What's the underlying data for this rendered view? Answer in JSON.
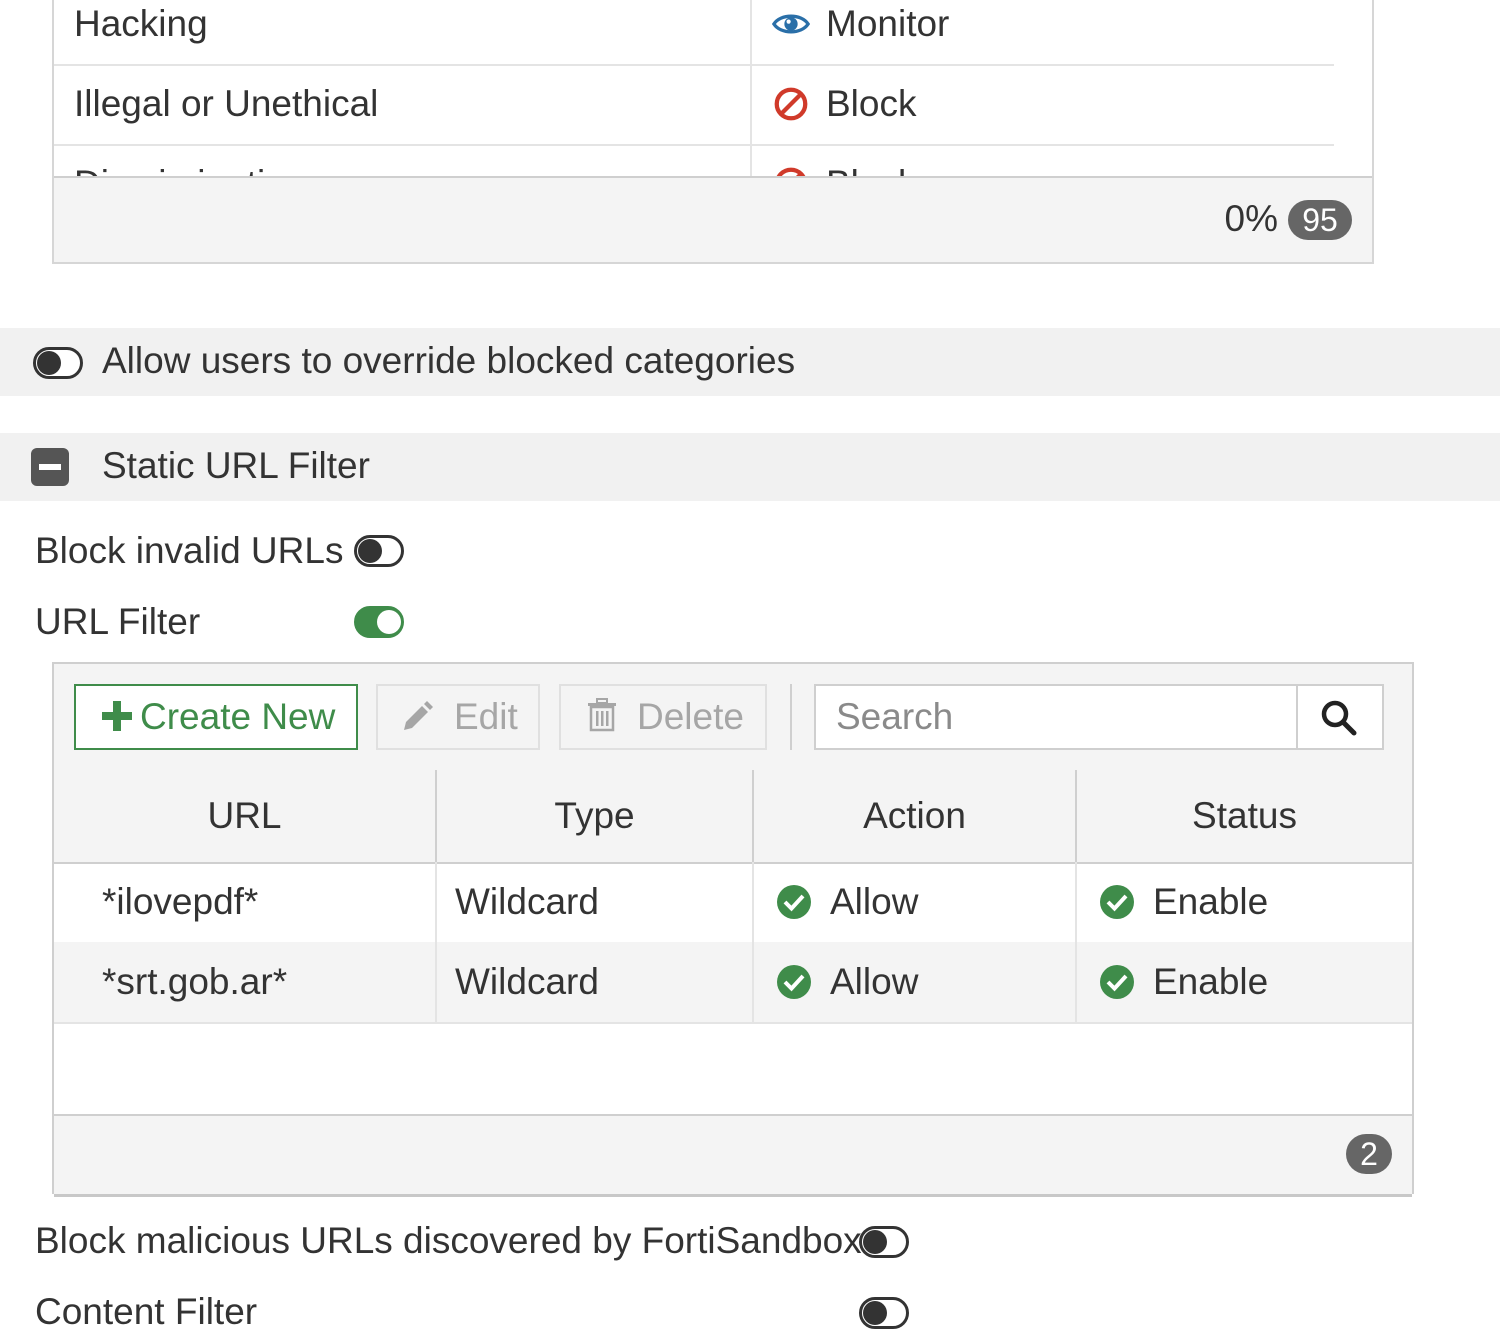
{
  "categories": {
    "rows": [
      {
        "name": "Hacking",
        "action": "Monitor",
        "action_icon": "eye-icon"
      },
      {
        "name": "Illegal or Unethical",
        "action": "Block",
        "action_icon": "block-icon"
      },
      {
        "name": "Discrimination",
        "action": "Block",
        "action_icon": "block-icon"
      }
    ],
    "footer_percent": "0%",
    "footer_count": "95"
  },
  "override": {
    "label": "Allow users to override blocked categories",
    "enabled": false
  },
  "static_url_filter": {
    "title": "Static URL Filter",
    "collapse_icon": "minus-square-icon",
    "block_invalid_urls": {
      "label": "Block invalid URLs",
      "enabled": false
    },
    "url_filter": {
      "label": "URL Filter",
      "enabled": true
    }
  },
  "toolbar": {
    "create_label": "Create New",
    "edit_label": "Edit",
    "delete_label": "Delete",
    "search_placeholder": "Search"
  },
  "table": {
    "columns": [
      "URL",
      "Type",
      "Action",
      "Status"
    ],
    "rows": [
      {
        "url": "*ilovepdf*",
        "type": "Wildcard",
        "action": "Allow",
        "status": "Enable"
      },
      {
        "url": "*srt.gob.ar*",
        "type": "Wildcard",
        "action": "Allow",
        "status": "Enable"
      }
    ],
    "count": "2"
  },
  "sandbox": {
    "label": "Block malicious URLs discovered by FortiSandbox",
    "enabled": false
  },
  "content_filter": {
    "label": "Content Filter",
    "enabled": false
  },
  "colors": {
    "accent_green": "#3f8c4a",
    "block_red": "#d03a2a",
    "monitor_blue": "#2a6fa8"
  }
}
